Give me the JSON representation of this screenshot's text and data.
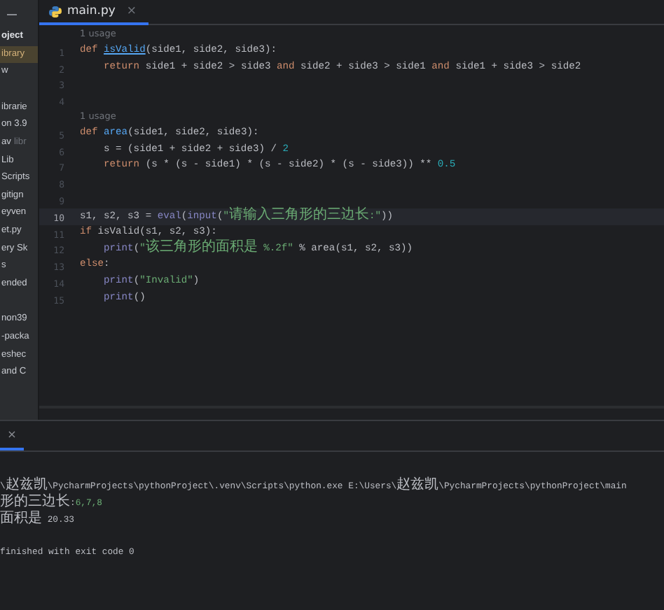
{
  "sidebar": {
    "sections": [
      {
        "items": [
          {
            "label": "oject",
            "bold": true,
            "selected": false
          },
          {
            "label": "ibrary",
            "bold": false,
            "selected": true
          },
          {
            "label": "w",
            "bold": false,
            "selected": false
          }
        ]
      },
      {
        "items": [
          {
            "label": "ibrarie",
            "bold": false,
            "selected": false
          },
          {
            "label": "on 3.9",
            "bold": false,
            "selected": false
          },
          {
            "label": "av",
            "hint": "libr",
            "bold": false,
            "selected": false
          },
          {
            "label": "Lib",
            "bold": false,
            "selected": false
          },
          {
            "label": "Scripts",
            "bold": false,
            "selected": false
          },
          {
            "label": "gitign",
            "bold": false,
            "selected": false
          },
          {
            "label": "eyven",
            "bold": false,
            "selected": false
          },
          {
            "label": "et.py",
            "bold": false,
            "selected": false
          },
          {
            "label": "ery Sk",
            "bold": false,
            "selected": false
          },
          {
            "label": "s",
            "bold": false,
            "selected": false
          },
          {
            "label": "ended",
            "bold": false,
            "selected": false
          }
        ]
      },
      {
        "items": [
          {
            "label": "non39",
            "bold": false,
            "selected": false
          },
          {
            "label": "-packa",
            "bold": false,
            "selected": false
          },
          {
            "label": "eshec",
            "bold": false,
            "selected": false
          },
          {
            "label": "and C",
            "bold": false,
            "selected": false
          }
        ]
      }
    ]
  },
  "tabs": [
    {
      "label": "main.py",
      "close": "×",
      "selected": true
    }
  ],
  "editor": {
    "lines": [
      {
        "number": "1",
        "hint": "1 usage",
        "current": false,
        "tokens": [
          {
            "kind": "keyword",
            "text": "def "
          },
          {
            "kind": "def",
            "text": "isValid"
          },
          {
            "kind": "plain",
            "text": "(side1, side2, side3):"
          }
        ]
      },
      {
        "number": "2",
        "current": false,
        "tokens": [
          {
            "kind": "keyword",
            "text": "    return "
          },
          {
            "kind": "plain",
            "text": "side1 + side2 > side3 "
          },
          {
            "kind": "keyword",
            "text": "and "
          },
          {
            "kind": "plain",
            "text": "side2 + side3 > side1 "
          },
          {
            "kind": "keyword",
            "text": "and "
          },
          {
            "kind": "plain",
            "text": "side1 + side3 > side2"
          }
        ]
      },
      {
        "number": "3",
        "current": false
      },
      {
        "number": "4",
        "current": false
      },
      {
        "number": "5",
        "hint": "1 usage",
        "current": false,
        "tokens": [
          {
            "kind": "keyword",
            "text": "def "
          },
          {
            "kind": "fn",
            "text": "area"
          },
          {
            "kind": "plain",
            "text": "(side1, side2, side3):"
          }
        ]
      },
      {
        "number": "6",
        "current": false,
        "tokens": [
          {
            "kind": "plain",
            "text": "    s = (side1 + side2 + side3) / "
          },
          {
            "kind": "number",
            "text": "2"
          }
        ]
      },
      {
        "number": "7",
        "current": false,
        "tokens": [
          {
            "kind": "keyword",
            "text": "    return "
          },
          {
            "kind": "plain",
            "text": "(s * (s - side1) * (s - side2) * (s - side3)) ** "
          },
          {
            "kind": "number",
            "text": "0.5"
          }
        ]
      },
      {
        "number": "8",
        "current": false
      },
      {
        "number": "9",
        "current": false
      },
      {
        "number": "10",
        "current": true,
        "tokens": [
          {
            "kind": "plain",
            "text": "s1, s2, s3 = "
          },
          {
            "kind": "builtin",
            "text": "eval"
          },
          {
            "kind": "plain",
            "text": "("
          },
          {
            "kind": "builtin",
            "text": "input"
          },
          {
            "kind": "plain",
            "text": "("
          },
          {
            "kind": "string",
            "text": "\"请输入三角形的三边长:\""
          },
          {
            "kind": "plain",
            "text": "))"
          }
        ]
      },
      {
        "number": "11",
        "current": false,
        "tokens": [
          {
            "kind": "keyword",
            "text": "if "
          },
          {
            "kind": "plain",
            "text": "isValid(s1, s2, s3):"
          }
        ]
      },
      {
        "number": "12",
        "current": false,
        "tokens": [
          {
            "kind": "builtin",
            "text": "    print"
          },
          {
            "kind": "plain",
            "text": "("
          },
          {
            "kind": "string",
            "text": "\"该三角形的面积是 %.2f\""
          },
          {
            "kind": "plain",
            "text": " % area(s1, s2, s3))"
          }
        ]
      },
      {
        "number": "13",
        "current": false,
        "tokens": [
          {
            "kind": "keyword",
            "text": "else"
          },
          {
            "kind": "plain",
            "text": ":"
          }
        ]
      },
      {
        "number": "14",
        "current": false,
        "tokens": [
          {
            "kind": "builtin",
            "text": "    print"
          },
          {
            "kind": "plain",
            "text": "("
          },
          {
            "kind": "string",
            "text": "\"Invalid\""
          },
          {
            "kind": "plain",
            "text": ")"
          }
        ]
      },
      {
        "number": "15",
        "current": false,
        "tokens": [
          {
            "kind": "builtin",
            "text": "    print"
          },
          {
            "kind": "plain",
            "text": "()"
          }
        ]
      }
    ]
  },
  "run_panel": {
    "tab_close": "×",
    "lines": [
      {
        "kind": "output",
        "tokens": [
          {
            "kind": "plain",
            "text": "\\赵兹凯\\PycharmProjects\\pythonProject\\.venv\\Scripts\\python.exe E:\\Users\\赵兹凯\\PycharmProjects\\pythonProject\\main"
          }
        ]
      },
      {
        "kind": "output",
        "tokens": [
          {
            "kind": "plain",
            "text": "形的三边长:"
          },
          {
            "kind": "input",
            "text": "6,7,8"
          }
        ]
      },
      {
        "kind": "output",
        "tokens": [
          {
            "kind": "plain",
            "text": "面积是 20.33"
          }
        ]
      },
      {
        "kind": "blank"
      },
      {
        "kind": "output",
        "tokens": [
          {
            "kind": "plain",
            "text": "finished with exit code 0"
          }
        ]
      }
    ]
  }
}
